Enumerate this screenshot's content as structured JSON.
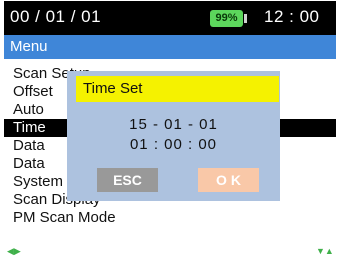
{
  "status": {
    "date": "00 / 01 / 01",
    "battery": "99%",
    "time": "12 : 00"
  },
  "menu": {
    "title": "Menu",
    "items": [
      {
        "label": "Scan Setup"
      },
      {
        "label": "Offset"
      },
      {
        "label": "Auto"
      },
      {
        "label": "Time"
      },
      {
        "label": "Data"
      },
      {
        "label": "Data"
      },
      {
        "label": "System Info"
      },
      {
        "label": "Scan Display"
      },
      {
        "label": "PM Scan Mode"
      }
    ],
    "selected": "Time"
  },
  "nav": {
    "left": "◀▶",
    "right": "▼▲"
  },
  "dialog": {
    "title": "Time Set",
    "date": "15 - 01 - 01",
    "time": "01 : 00 : 00",
    "esc_label": "ESC",
    "ok_label": "O K"
  },
  "colors": {
    "menu_header": "#3f86d8",
    "dialog_bg": "#adc2df",
    "dialog_title": "#f5f200",
    "battery": "#5cd65c",
    "ok_button": "#f9c8a8",
    "esc_button": "#999999"
  }
}
